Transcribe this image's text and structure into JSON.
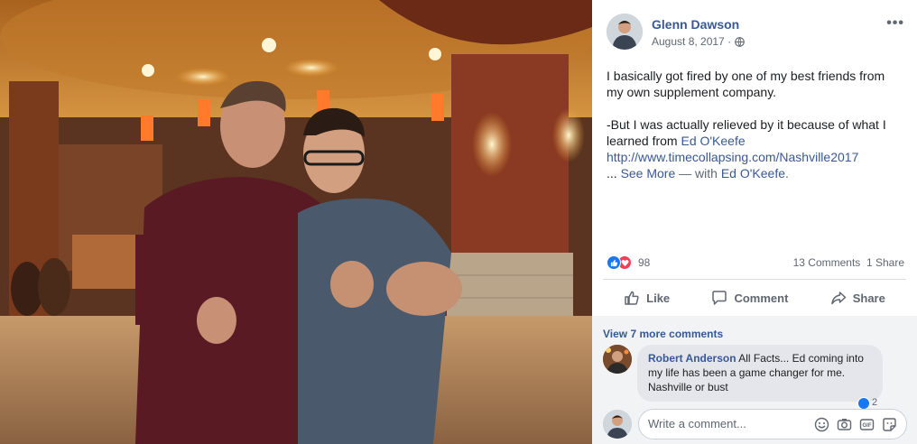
{
  "post": {
    "author": "Glenn Dawson",
    "date": "August 8, 2017 ·",
    "privacy_icon": "globe-icon",
    "more_icon": "more-options-icon",
    "more_glyph": "•••",
    "text": {
      "p1": "I basically got fired by one of my best friends from my own supplement company.",
      "p2_before": "-But I was actually relieved by it because of what I learned from ",
      "p2_link": "Ed O'Keefe",
      "url": "http://www.timecollapsing.com/Nashville2017",
      "ellipsis": "... ",
      "see_more": "See More",
      "with_prefix": " — with ",
      "tagged": "Ed O'Keefe",
      "period": "."
    }
  },
  "reactions": {
    "count": "98",
    "comments": "13 Comments",
    "shares": "1 Share"
  },
  "actions": {
    "like": "Like",
    "comment": "Comment",
    "share": "Share"
  },
  "comments": {
    "view_more": "View 7 more comments",
    "items": [
      {
        "name": "Robert Anderson",
        "text": " All Facts... Ed coming into my life has been a game changer for me. Nashville or bust",
        "reaction_count": "2"
      }
    ]
  },
  "composer": {
    "placeholder": "Write a comment...",
    "icons": [
      "emoji-icon",
      "camera-icon",
      "gif-icon",
      "sticker-icon"
    ]
  },
  "colors": {
    "link": "#385898",
    "like_blue": "#1877f2",
    "love_red": "#f33e58"
  }
}
